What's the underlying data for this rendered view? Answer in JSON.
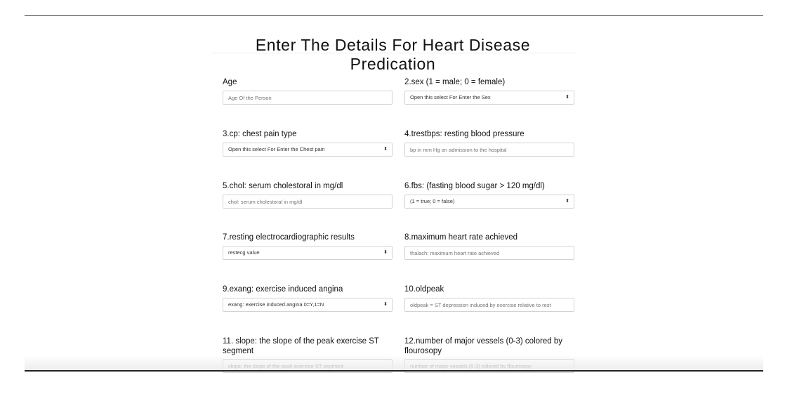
{
  "title": "Enter The Details For Heart Disease Predication",
  "fields": [
    {
      "label": "Age",
      "kind": "input",
      "placeholder": "Age Of the Person"
    },
    {
      "label": "2.sex (1 = male; 0 = female)",
      "kind": "select",
      "value": "Open this select For Enter the Sex"
    },
    {
      "label": "3.cp: chest pain type",
      "kind": "select",
      "value": "Open this select For Enter the Chest pain"
    },
    {
      "label": "4.trestbps: resting blood pressure",
      "kind": "input",
      "placeholder": "bp in mm Hg on admission to the hospital"
    },
    {
      "label": "5.chol: serum cholestoral in mg/dl",
      "kind": "input",
      "placeholder": "chol: serum cholestoral in mg/dl"
    },
    {
      "label": "6.fbs: (fasting blood sugar > 120 mg/dl)",
      "kind": "select",
      "value": "(1 = true; 0 = false)"
    },
    {
      "label": "7.resting electrocardiographic results",
      "kind": "select",
      "value": "restecg value"
    },
    {
      "label": "8.maximum heart rate achieved",
      "kind": "input",
      "placeholder": "thalach: maximum heart rate achieved"
    },
    {
      "label": "9.exang: exercise induced angina",
      "kind": "select",
      "value": "exang: exercise induced angina 0=Y,1=N"
    },
    {
      "label": "10.oldpeak",
      "kind": "input",
      "placeholder": "oldpeak = ST depression induced by exercise relative to rest"
    },
    {
      "label": "11. slope: the slope of the peak exercise ST segment",
      "kind": "input",
      "placeholder": "slope: the slope of the peak exercise ST segment"
    },
    {
      "label": "12.number of major vessels (0-3) colored by flourosopy",
      "kind": "input",
      "placeholder": "number of major vessels (0-3) colored by flourosopy"
    }
  ]
}
